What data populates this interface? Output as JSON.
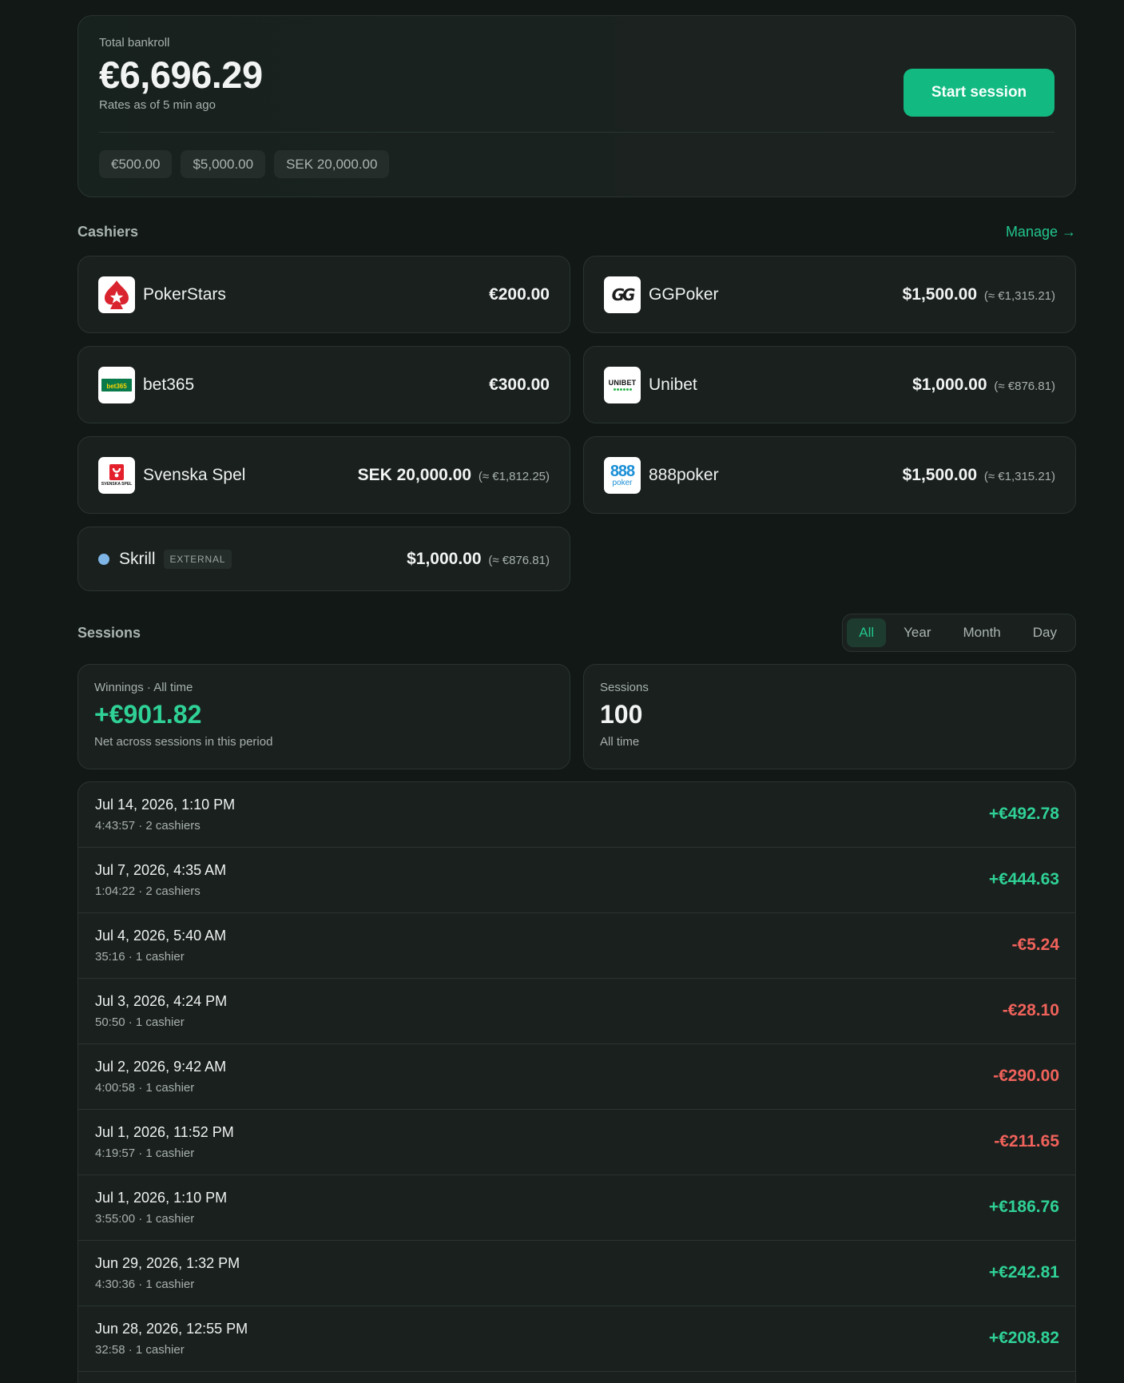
{
  "bankroll": {
    "label": "Total bankroll",
    "total": "€6,696.29",
    "rates_note": "Rates as of 5 min ago",
    "start_button": "Start session",
    "balances": [
      "€500.00",
      "$5,000.00",
      "SEK 20,000.00"
    ]
  },
  "cashiers_section": {
    "title": "Cashiers",
    "manage_link": "Manage →",
    "items": [
      {
        "name": "PokerStars",
        "amount": "€200.00",
        "approx": "",
        "logo": "pokerstars-logo"
      },
      {
        "name": "GGPoker",
        "amount": "$1,500.00",
        "approx": "(≈ €1,315.21)",
        "logo": "ggpoker-logo"
      },
      {
        "name": "bet365",
        "amount": "€300.00",
        "approx": "",
        "logo": "bet365-logo"
      },
      {
        "name": "Unibet",
        "amount": "$1,000.00",
        "approx": "(≈ €876.81)",
        "logo": "unibet-logo"
      },
      {
        "name": "Svenska Spel",
        "amount": "SEK 20,000.00",
        "approx": "(≈ €1,812.25)",
        "logo": "svenska-spel-logo"
      },
      {
        "name": "888poker",
        "amount": "$1,500.00",
        "approx": "(≈ €1,315.21)",
        "logo": "888poker-logo"
      },
      {
        "name": "Skrill",
        "badge": "EXTERNAL",
        "amount": "$1,000.00",
        "approx": "(≈ €876.81)",
        "logo": "status-dot",
        "dot_color": "#7eb5e6"
      }
    ],
    "logo_text": {
      "ggpoker": "GG",
      "bet365": "bet365",
      "unibet": "UNIBET",
      "svenska": "SVENSKA SPEL",
      "eight_top": "888",
      "eight_bottom": "poker"
    }
  },
  "sessions_section": {
    "title": "Sessions",
    "tabs": [
      "All",
      "Year",
      "Month",
      "Day"
    ],
    "active_tab": "All",
    "winnings": {
      "label": "Winnings · All time",
      "value": "+€901.82",
      "sub": "Net across sessions in this period"
    },
    "count": {
      "label": "Sessions",
      "value": "100",
      "sub": "All time"
    },
    "rows": [
      {
        "when": "Jul 14, 2026, 1:10 PM",
        "meta": "4:43:57 · 2 cashiers",
        "result": "+€492.78",
        "positive": true
      },
      {
        "when": "Jul 7, 2026, 4:35 AM",
        "meta": "1:04:22 · 2 cashiers",
        "result": "+€444.63",
        "positive": true
      },
      {
        "when": "Jul 4, 2026, 5:40 AM",
        "meta": "35:16 · 1 cashier",
        "result": "-€5.24",
        "positive": false
      },
      {
        "when": "Jul 3, 2026, 4:24 PM",
        "meta": "50:50 · 1 cashier",
        "result": "-€28.10",
        "positive": false
      },
      {
        "when": "Jul 2, 2026, 9:42 AM",
        "meta": "4:00:58 · 1 cashier",
        "result": "-€290.00",
        "positive": false
      },
      {
        "when": "Jul 1, 2026, 11:52 PM",
        "meta": "4:19:57 · 1 cashier",
        "result": "-€211.65",
        "positive": false
      },
      {
        "when": "Jul 1, 2026, 1:10 PM",
        "meta": "3:55:00 · 1 cashier",
        "result": "+€186.76",
        "positive": true
      },
      {
        "when": "Jun 29, 2026, 1:32 PM",
        "meta": "4:30:36 · 1 cashier",
        "result": "+€242.81",
        "positive": true
      },
      {
        "when": "Jun 28, 2026, 12:55 PM",
        "meta": "32:58 · 1 cashier",
        "result": "+€208.82",
        "positive": true
      }
    ]
  },
  "colors": {
    "accent": "#12b981",
    "positive": "#2fd196",
    "negative": "#f0625b",
    "background": "#111816",
    "card": "#1a201e"
  }
}
